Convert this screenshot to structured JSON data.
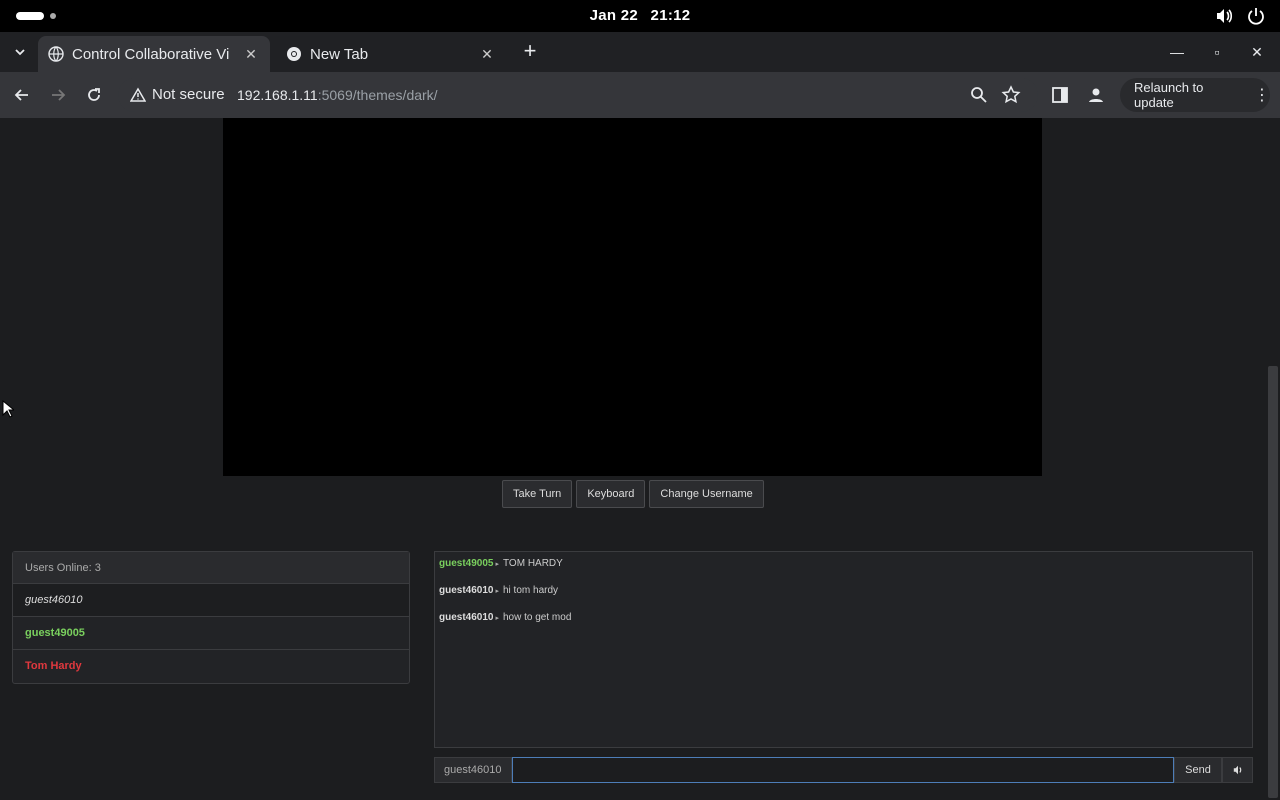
{
  "system": {
    "date": "Jan 22",
    "time": "21:12"
  },
  "tabs": [
    {
      "title": "Control Collaborative Vi",
      "active": true
    },
    {
      "title": "New Tab",
      "active": false
    }
  ],
  "toolbar": {
    "security_label": "Not secure",
    "url_host": "192.168.1.11",
    "url_rest": ":5069/themes/dark/",
    "relaunch_label": "Relaunch to update"
  },
  "controls": {
    "take_turn": "Take Turn",
    "keyboard": "Keyboard",
    "change_username": "Change Username"
  },
  "users": {
    "header": "Users Online: 3",
    "list": [
      {
        "name": "guest46010",
        "style": "self"
      },
      {
        "name": "guest49005",
        "style": "green"
      },
      {
        "name": "Tom Hardy",
        "style": "red"
      }
    ]
  },
  "chat": {
    "messages": [
      {
        "user": "guest49005",
        "text": "TOM HARDY",
        "color": "green"
      },
      {
        "user": "guest46010",
        "text": "hi tom hardy",
        "color": "default"
      },
      {
        "user": "guest46010",
        "text": "how to get mod",
        "color": "default"
      }
    ],
    "username": "guest46010",
    "input_value": "",
    "send_label": "Send"
  },
  "colors": {
    "green_user": "#7ad05e",
    "red_user": "#e0383e",
    "input_focus": "#4d7db8"
  }
}
